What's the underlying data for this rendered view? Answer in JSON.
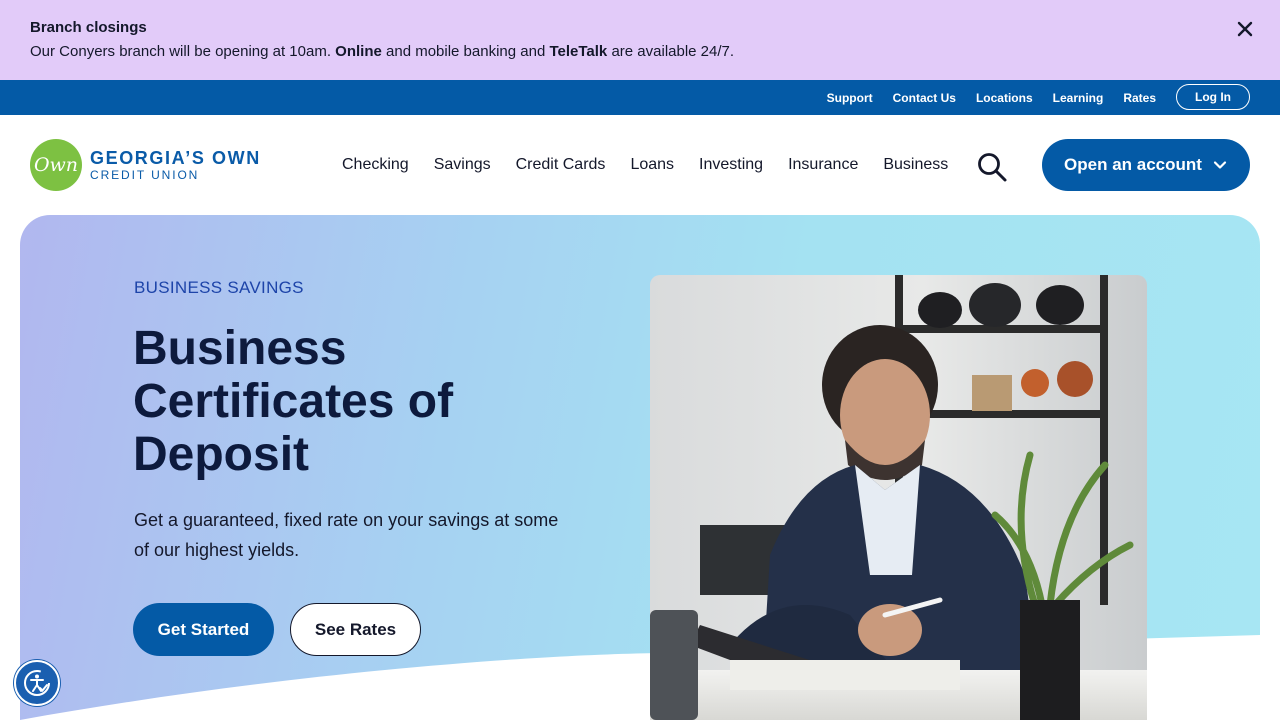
{
  "alert": {
    "title": "Branch closings",
    "message_before": "Our Conyers branch will be opening at 10am. ",
    "online": "Online",
    "message_middle": " and mobile banking and ",
    "teletalk": "TeleTalk",
    "message_after": " are available 24/7."
  },
  "utility": {
    "links": [
      "Support",
      "Contact Us",
      "Locations",
      "Learning",
      "Rates"
    ],
    "login_label": "Log In"
  },
  "logo": {
    "mark": "Own",
    "line1": "GEORGIA’S OWN",
    "line2": "CREDIT UNION"
  },
  "nav": {
    "items": [
      "Checking",
      "Savings",
      "Credit Cards",
      "Loans",
      "Investing",
      "Insurance",
      "Business"
    ],
    "open_account_label": "Open an account"
  },
  "hero": {
    "eyebrow": "BUSINESS SAVINGS",
    "title": "Business Certificates of Deposit",
    "description": "Get a guaranteed, fixed rate on your savings at some of our highest yields.",
    "primary_button": "Get Started",
    "secondary_button": "See Rates"
  },
  "colors": {
    "alert_bg": "#e2cbf9",
    "brand_blue": "#045aa6",
    "logo_green": "#7dc142",
    "heading_navy": "#0d1a3d"
  },
  "icons": {
    "close": "close-icon",
    "search": "search-icon",
    "chevron": "chevron-down-icon",
    "accessibility": "accessibility-icon"
  }
}
